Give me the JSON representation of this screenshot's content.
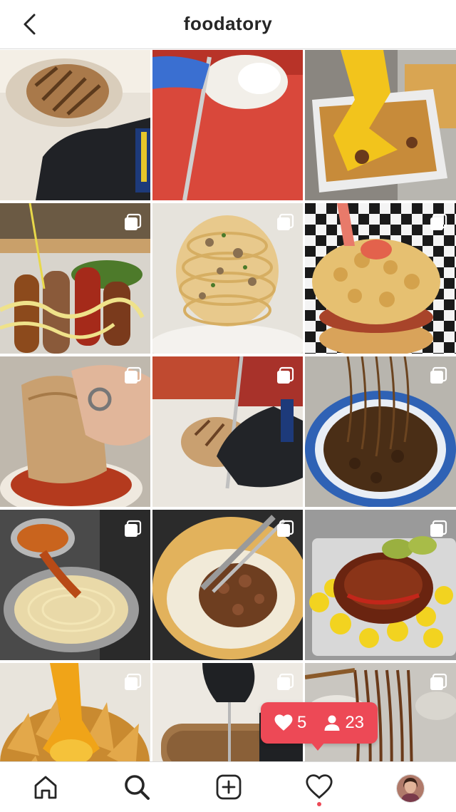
{
  "header": {
    "title": "foodatory"
  },
  "grid": {
    "posts": [
      {
        "name": "post-grilled-burrito",
        "multi": false
      },
      {
        "name": "post-cutting-burrito",
        "multi": false
      },
      {
        "name": "post-cheese-fries",
        "multi": false
      },
      {
        "name": "post-sausages-sauce",
        "multi": true
      },
      {
        "name": "post-mushroom-fettuccine",
        "multi": true
      },
      {
        "name": "post-mac-cheese-burger",
        "multi": true
      },
      {
        "name": "post-burrito-dip",
        "multi": true
      },
      {
        "name": "post-knife-burrito",
        "multi": true
      },
      {
        "name": "post-black-noodles",
        "multi": true
      },
      {
        "name": "post-spaghetti-sauce",
        "multi": true
      },
      {
        "name": "post-quesadilla-meat",
        "multi": true
      },
      {
        "name": "post-mac-ribs",
        "multi": true
      },
      {
        "name": "post-blooming-onion",
        "multi": true
      },
      {
        "name": "post-sliced-burrito",
        "multi": true
      },
      {
        "name": "post-noodle-pull",
        "multi": true
      }
    ]
  },
  "activity_badge": {
    "likes": "5",
    "followers": "23"
  },
  "tabbar": {
    "items": [
      "home-icon",
      "search-icon",
      "create-icon",
      "activity-icon",
      "profile-avatar"
    ]
  },
  "colors": {
    "accent": "#ed4956",
    "text": "#262626",
    "divider": "#dbdbdb"
  }
}
